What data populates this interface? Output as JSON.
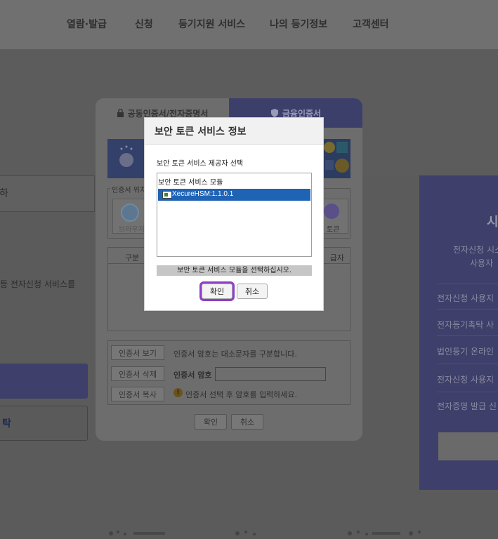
{
  "nav": {
    "items": [
      "열람·발급",
      "신청",
      "등기지원 서비스",
      "나의 등기정보",
      "고객센터"
    ]
  },
  "background": {
    "left_box_label": "하",
    "left_text": "등 전자신청 서비스를",
    "left_button_label": "탁",
    "right_panel": {
      "title": "시",
      "line1": "전자신청 시스",
      "line2": "사용자",
      "items": [
        "전자신청 사용지",
        "전자등기촉탁 사",
        "법인등기 온라인",
        "전자신청 사용지",
        "전자증명 발급 신"
      ]
    }
  },
  "cert_dialog": {
    "tabs": {
      "public": "공동인증서/전자증명서",
      "finance": "금융인증서"
    },
    "location_legend": "인증서 위치",
    "location_browser": "브라우저",
    "location_token": "토큰",
    "table_headers": {
      "first": "구분",
      "last": "급자"
    },
    "actions": {
      "view": "인증서 보기",
      "delete": "인증서 삭제",
      "copy": "인증서 복사",
      "case_note": "인증서 암호는 대소문자를 구분합니다.",
      "password_label": "인증서 암호",
      "warning": "인증서 선택 후 암호를 입력하세요."
    },
    "buttons": {
      "ok": "확인",
      "cancel": "취소"
    }
  },
  "token_modal": {
    "title": "보안 토큰 서비스 정보",
    "provider_label": "보안 토큰 서비스 제공자 선택",
    "list_header": "보안 토큰 서비스 모듈",
    "modules": [
      "XecureHSM:1.1.0.1"
    ],
    "selected_module": "XecureHSM:1.1.0.1",
    "status": "보안 토큰 서비스 모듈을 선택하십시오.",
    "ok_label": "확인",
    "cancel_label": "취소"
  },
  "colors": {
    "accent_highlight": "#8e3fc8",
    "selection": "#1f63b4",
    "finance_tab": "#3d3f6b"
  }
}
